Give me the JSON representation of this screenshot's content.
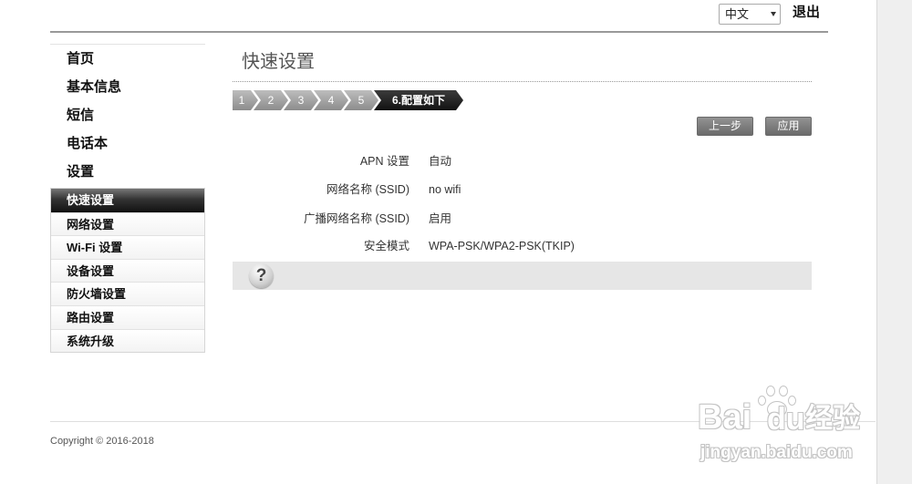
{
  "header": {
    "language_select": {
      "selected": "中文"
    },
    "logout_label": "退出"
  },
  "sidebar": {
    "main_items": [
      {
        "label": "首页"
      },
      {
        "label": "基本信息"
      },
      {
        "label": "短信"
      },
      {
        "label": "电话本"
      },
      {
        "label": "设置"
      }
    ],
    "sub_items": [
      {
        "label": "快速设置",
        "active": true
      },
      {
        "label": "网络设置",
        "active": false
      },
      {
        "label": "Wi-Fi 设置",
        "active": false
      },
      {
        "label": "设备设置",
        "active": false
      },
      {
        "label": "防火墙设置",
        "active": false
      },
      {
        "label": "路由设置",
        "active": false
      },
      {
        "label": "系统升级",
        "active": false
      }
    ]
  },
  "main": {
    "title": "快速设置",
    "steps": [
      {
        "label": "1",
        "active": false
      },
      {
        "label": "2",
        "active": false
      },
      {
        "label": "3",
        "active": false
      },
      {
        "label": "4",
        "active": false
      },
      {
        "label": "5",
        "active": false
      },
      {
        "label": "6.配置如下",
        "active": true
      }
    ],
    "buttons": {
      "prev_label": "上一步",
      "apply_label": "应用"
    },
    "summary_rows": [
      {
        "label": "APN 设置",
        "value": "自动"
      },
      {
        "label": "网络名称 (SSID)",
        "value": "no wifi"
      },
      {
        "label": "广播网络名称 (SSID)",
        "value": "启用"
      },
      {
        "label": "安全模式",
        "value": "WPA-PSK/WPA2-PSK(TKIP)"
      }
    ],
    "help": {
      "glyph": "?"
    }
  },
  "footer": {
    "copyright": "Copyright © 2016-2018"
  },
  "watermark": {
    "brand_left": "Bai",
    "brand_right": "du",
    "brand_cn": "经验",
    "url": "jingyan.baidu.com"
  },
  "icons": {
    "language_select_arrow": "chevron-down-icon",
    "help": "help-icon",
    "watermark_logo": "paw-icon"
  },
  "colors": {
    "menu_active_top": "#777777",
    "menu_active_bottom": "#111111",
    "step_top": "#bdbdbd",
    "step_bottom": "#8c8c8c",
    "step_active": "#111111",
    "button_top": "#929292",
    "button_bottom": "#6b6b6b",
    "help_bar": "#e6e6e6",
    "side_strip": "#efefef",
    "header_rule": "#999999"
  }
}
